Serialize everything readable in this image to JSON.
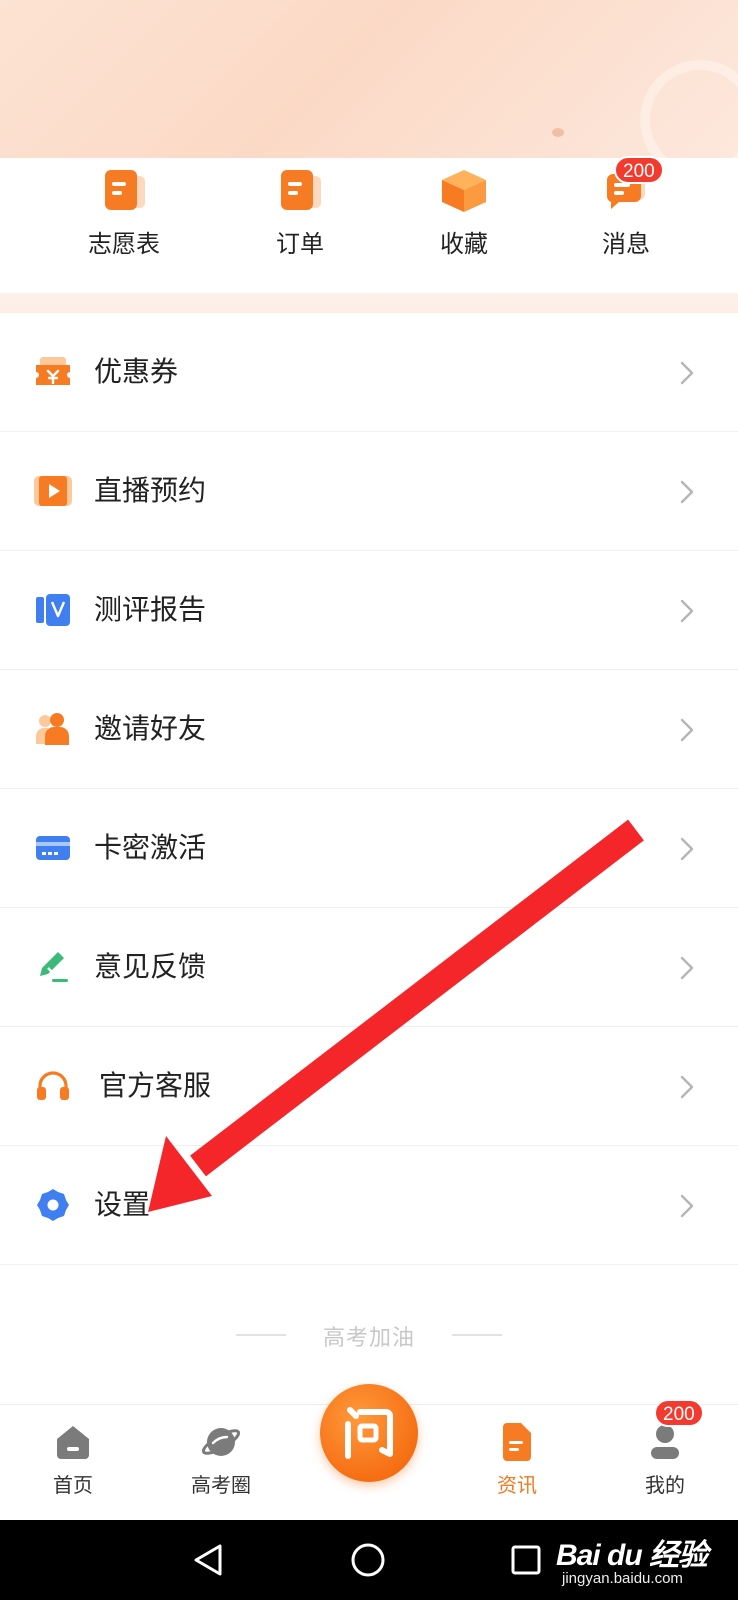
{
  "quick_actions": [
    {
      "label": "志愿表",
      "icon": "form-doc-icon"
    },
    {
      "label": "订单",
      "icon": "order-doc-icon"
    },
    {
      "label": "收藏",
      "icon": "box-icon"
    },
    {
      "label": "消息",
      "icon": "chat-icon",
      "badge": "200"
    }
  ],
  "menu": [
    {
      "label": "优惠券",
      "icon": "coupon-icon"
    },
    {
      "label": "直播预约",
      "icon": "live-play-icon"
    },
    {
      "label": "测评报告",
      "icon": "report-icon"
    },
    {
      "label": "邀请好友",
      "icon": "invite-user-icon"
    },
    {
      "label": "卡密激活",
      "icon": "card-icon"
    },
    {
      "label": "意见反馈",
      "icon": "edit-pen-icon"
    },
    {
      "label": "官方客服",
      "icon": "headset-icon"
    },
    {
      "label": "设置",
      "icon": "gear-icon"
    }
  ],
  "footer_text": "高考加油",
  "tabbar": {
    "home": "首页",
    "circle": "高考圈",
    "ask": "问",
    "news": "资讯",
    "mine": "我的",
    "mine_badge": "200",
    "active": "资讯"
  },
  "watermark": {
    "brand": "Bai du 经验",
    "url": "jingyan.baidu.com"
  },
  "colors": {
    "accent": "#f07a1f",
    "badge": "#f23b2e",
    "arrow": "#f5262a",
    "blue": "#3f7fef",
    "green": "#3cba7a"
  }
}
